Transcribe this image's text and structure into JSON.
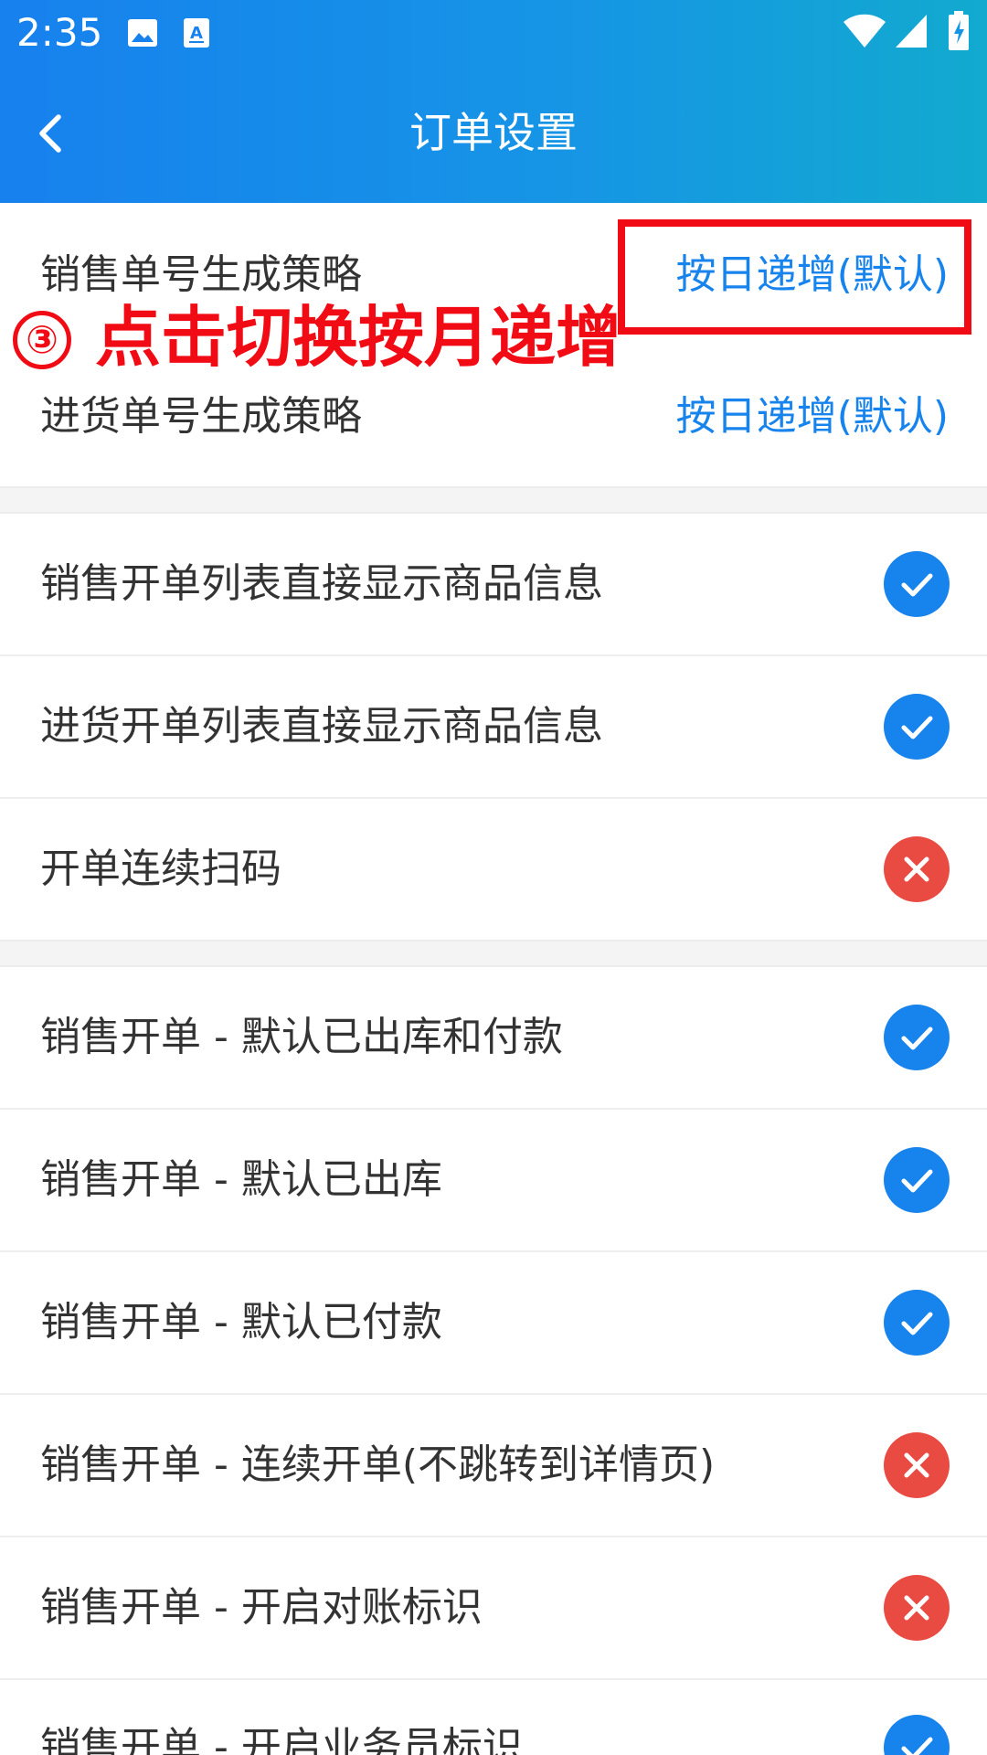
{
  "status_bar": {
    "time": "2:35",
    "left_icons": [
      "image-icon",
      "text-recognition-icon"
    ],
    "right_icons": [
      "wifi-icon",
      "signal-icon",
      "battery-charging-icon"
    ]
  },
  "nav": {
    "title": "订单设置",
    "back_icon": "chevron-left-icon"
  },
  "colors": {
    "header_start": "#1781ee",
    "header_end": "#12aacf",
    "link": "#1783ec",
    "toggle_on": "#1783ec",
    "toggle_off": "#e94b43",
    "annotation": "#f10b14"
  },
  "number_strategies": [
    {
      "label": "销售单号生成策略",
      "value": "按日递增(默认)"
    },
    {
      "label": "进货单号生成策略",
      "value": "按日递增(默认)"
    }
  ],
  "list_settings": [
    {
      "label": "销售开单列表直接显示商品信息",
      "enabled": true
    },
    {
      "label": "进货开单列表直接显示商品信息",
      "enabled": true
    },
    {
      "label": "开单连续扫码",
      "enabled": false
    }
  ],
  "sales_settings": [
    {
      "label": "销售开单 - 默认已出库和付款",
      "enabled": true
    },
    {
      "label": "销售开单 - 默认已出库",
      "enabled": true
    },
    {
      "label": "销售开单 - 默认已付款",
      "enabled": true
    },
    {
      "label": "销售开单 - 连续开单(不跳转到详情页)",
      "enabled": false
    },
    {
      "label": "销售开单 - 开启对账标识",
      "enabled": false
    },
    {
      "label": "销售开单 - 开启业务员标识",
      "enabled": true
    }
  ],
  "annotation": {
    "step": "③",
    "text": "点击切换按月递增"
  }
}
